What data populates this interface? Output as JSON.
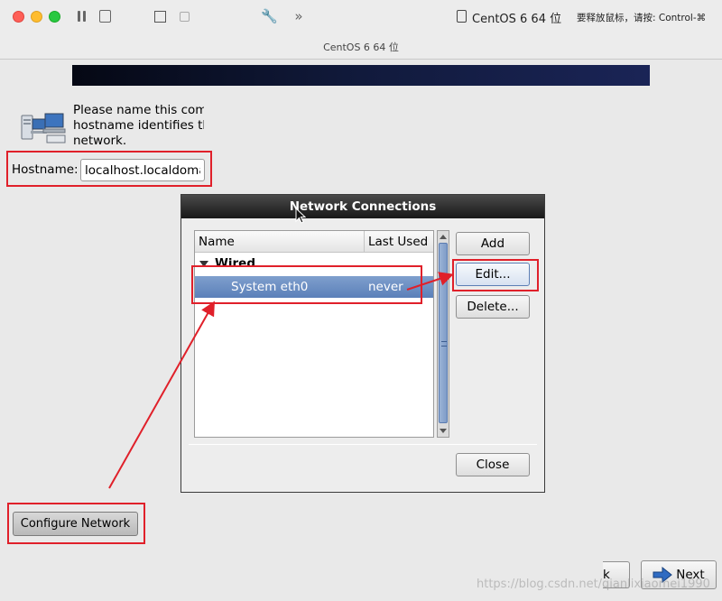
{
  "mac_window": {
    "vm_name": "CentOS 6 64 位",
    "release_hint": "要释放鼠标，请按: Control-⌘",
    "title": "CentOS 6 64 位"
  },
  "installer": {
    "intro_lines": [
      "Please name this com",
      "hostname identifies th",
      "network."
    ],
    "hostname_label": "Hostname:",
    "hostname_value": "localhost.localdoma",
    "configure_button": "Configure Network",
    "back_button": "k",
    "next_button": "Next"
  },
  "dialog": {
    "title": "Network Connections",
    "columns": [
      "Name",
      "Last Used"
    ],
    "group": "Wired",
    "connection": {
      "name": "System eth0",
      "last_used": "never"
    },
    "buttons": {
      "add": "Add",
      "edit": "Edit...",
      "delete": "Delete...",
      "close": "Close"
    }
  },
  "watermark": "https://blog.csdn.net/qianlixiaomei1990",
  "colors": {
    "annotation": "#e0202a",
    "selection": "#5b80b9",
    "banner": "#111a3c"
  }
}
